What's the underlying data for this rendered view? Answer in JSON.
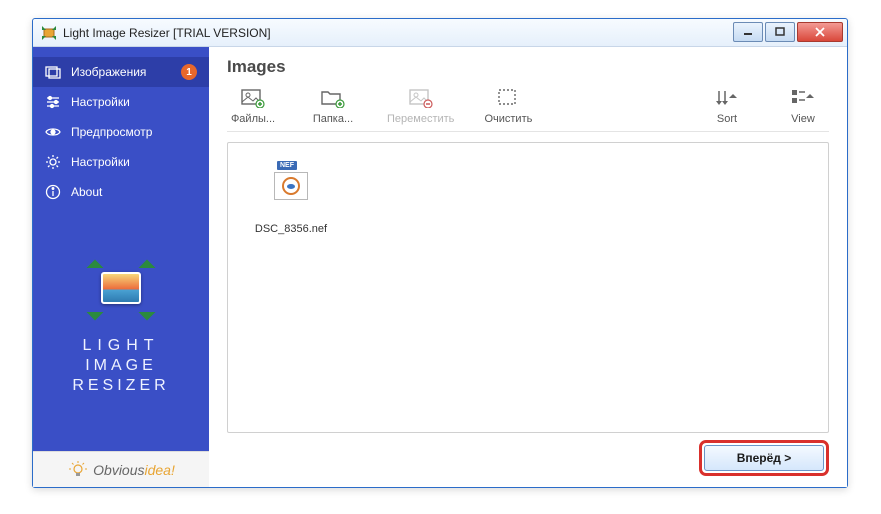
{
  "titlebar": {
    "title": "Light Image Resizer  [TRIAL VERSION]"
  },
  "sidebar": {
    "items": [
      {
        "label": "Изображения",
        "badge": "1"
      },
      {
        "label": "Настройки"
      },
      {
        "label": "Предпросмотр"
      },
      {
        "label": "Настройки"
      },
      {
        "label": "About"
      }
    ],
    "logo_lines": {
      "l1": "LIGHT",
      "l2": "IMAGE",
      "l3": "RESIZER"
    },
    "brand": {
      "part1": "Obvious",
      "part2": "idea",
      "exclaim": "!"
    }
  },
  "main": {
    "title": "Images",
    "toolbar": {
      "files": "Файлы...",
      "folder": "Папка...",
      "move": "Переместить",
      "clear": "Очистить",
      "sort": "Sort",
      "view": "View"
    },
    "files": [
      {
        "name": "DSC_8356.nef",
        "tag": "NEF"
      }
    ],
    "next_label": "Вперёд >"
  }
}
